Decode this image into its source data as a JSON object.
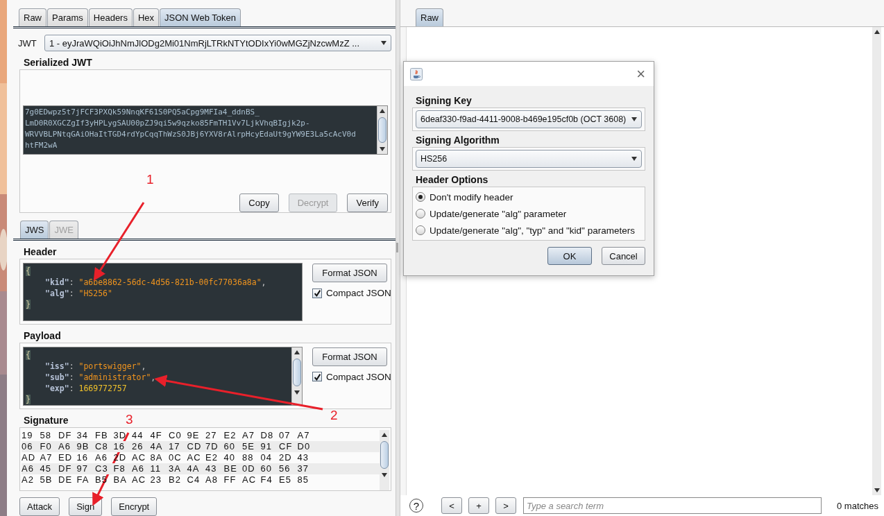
{
  "request_tabs": [
    {
      "label": "Raw",
      "selected": false
    },
    {
      "label": "Params",
      "selected": false
    },
    {
      "label": "Headers",
      "selected": false
    },
    {
      "label": "Hex",
      "selected": false
    },
    {
      "label": "JSON Web Token",
      "selected": true
    }
  ],
  "jwt": {
    "label": "JWT",
    "value": "1 - eyJraWQiOiJhNmJlODg2Mi01NmRjLTRkNTYtODIxYi0wMGZjNzcwMzZ ..."
  },
  "serialized": {
    "title": "Serialized JWT",
    "lines": [
      "7g0EDwpz5t7jFCF3PXQk59NnqKF61S0PQ5aCpg9MFIa4_ddnBS_",
      "LmD0R0XGCZgIf3yHPLygSAU00pZJ9qi5w9qzko85FmTH1Vv7LjkVhqBIgjk2p-",
      "WRVVBLPNtqGAiOHaItTGD4rdYpCqqThWzS0JBj6YXV8rAlrpHcyEdaUt9gYW9E3La5cAcV0d",
      "htFM2wA"
    ],
    "buttons": [
      {
        "label": "Copy",
        "disabled": false
      },
      {
        "label": "Decrypt",
        "disabled": true
      },
      {
        "label": "Verify",
        "disabled": false
      }
    ]
  },
  "sub_tabs": [
    {
      "label": "JWS",
      "selected": true,
      "disabled": false
    },
    {
      "label": "JWE",
      "selected": false,
      "disabled": true
    }
  ],
  "header": {
    "title": "Header",
    "format_button": "Format JSON",
    "compact": {
      "label": "Compact JSON",
      "checked": true
    },
    "scrollbar": false,
    "lines": [
      {
        "kind": "brace",
        "tokens": [
          {
            "kind": "brace",
            "text": "{"
          }
        ]
      },
      {
        "kind": "entry",
        "tokens": [
          {
            "kind": "key",
            "text": "\"kid\""
          },
          {
            "kind": "punct",
            "text": ": "
          },
          {
            "kind": "string",
            "text": "\"a6be8862-56dc-4d56-821b-00fc77036a8a\""
          },
          {
            "kind": "punct",
            "text": ","
          }
        ]
      },
      {
        "kind": "entry",
        "tokens": [
          {
            "kind": "key",
            "text": "\"alg\""
          },
          {
            "kind": "punct",
            "text": ": "
          },
          {
            "kind": "string",
            "text": "\"HS256\""
          }
        ]
      },
      {
        "kind": "brace",
        "tokens": [
          {
            "kind": "brace",
            "text": "}"
          }
        ]
      }
    ]
  },
  "payload": {
    "title": "Payload",
    "format_button": "Format JSON",
    "compact": {
      "label": "Compact JSON",
      "checked": true
    },
    "scrollbar": true,
    "lines": [
      {
        "kind": "brace",
        "tokens": [
          {
            "kind": "brace",
            "text": "{"
          }
        ]
      },
      {
        "kind": "entry",
        "tokens": [
          {
            "kind": "key",
            "text": "\"iss\""
          },
          {
            "kind": "punct",
            "text": ": "
          },
          {
            "kind": "string",
            "text": "\"portswigger\""
          },
          {
            "kind": "punct",
            "text": ","
          }
        ]
      },
      {
        "kind": "entry",
        "tokens": [
          {
            "kind": "key",
            "text": "\"sub\""
          },
          {
            "kind": "punct",
            "text": ": "
          },
          {
            "kind": "string",
            "text": "\"administrator\""
          },
          {
            "kind": "punct",
            "text": ","
          }
        ]
      },
      {
        "kind": "entry",
        "tokens": [
          {
            "kind": "key",
            "text": "\"exp\""
          },
          {
            "kind": "punct",
            "text": ": "
          },
          {
            "kind": "number",
            "text": "1669772757"
          }
        ]
      },
      {
        "kind": "brace",
        "tokens": [
          {
            "kind": "brace",
            "text": "}"
          }
        ]
      }
    ]
  },
  "signature": {
    "title": "Signature",
    "rows": [
      [
        "19",
        "58",
        "DF",
        "34",
        "FB",
        "3D",
        "44",
        "4F",
        "C0",
        "9E",
        "27",
        "E2",
        "A7",
        "D8",
        "07",
        "A7"
      ],
      [
        "06",
        "F0",
        "A6",
        "9B",
        "C8",
        "16",
        "26",
        "4A",
        "17",
        "CD",
        "7D",
        "60",
        "5E",
        "91",
        "CF",
        "D0"
      ],
      [
        "AD",
        "A7",
        "ED",
        "16",
        "A6",
        "2D",
        "AC",
        "8A",
        "0C",
        "AC",
        "E2",
        "40",
        "88",
        "04",
        "2D",
        "43"
      ],
      [
        "A6",
        "45",
        "DF",
        "97",
        "C3",
        "F8",
        "A6",
        "11",
        "3A",
        "4A",
        "43",
        "BE",
        "0D",
        "60",
        "56",
        "37"
      ],
      [
        "A2",
        "5B",
        "DE",
        "FA",
        "B5",
        "BA",
        "AC",
        "23",
        "B2",
        "C4",
        "A8",
        "FF",
        "AC",
        "F4",
        "E5",
        "85"
      ]
    ]
  },
  "actions": [
    "Attack",
    "Sign",
    "Encrypt"
  ],
  "response_tabs": [
    {
      "label": "Raw",
      "selected": true
    }
  ],
  "search": {
    "help": "?",
    "buttons": [
      "<",
      "+",
      ">"
    ],
    "placeholder": "Type a search term",
    "matches": "0 matches"
  },
  "dialog": {
    "close": "×",
    "key_label": "Signing Key",
    "key_value": "6deaf330-f9ad-4411-9008-b469e195cf0b (OCT 3608)",
    "alg_label": "Signing Algorithm",
    "alg_value": "HS256",
    "options_label": "Header Options",
    "options": [
      {
        "label": "Don't modify header",
        "selected": true
      },
      {
        "label": "Update/generate \"alg\" parameter",
        "selected": false
      },
      {
        "label": "Update/generate \"alg\", \"typ\" and \"kid\" parameters",
        "selected": false
      }
    ],
    "buttons": [
      {
        "label": "OK",
        "default": true
      },
      {
        "label": "Cancel",
        "default": false
      }
    ]
  },
  "annotations": [
    "1",
    "2",
    "3"
  ]
}
